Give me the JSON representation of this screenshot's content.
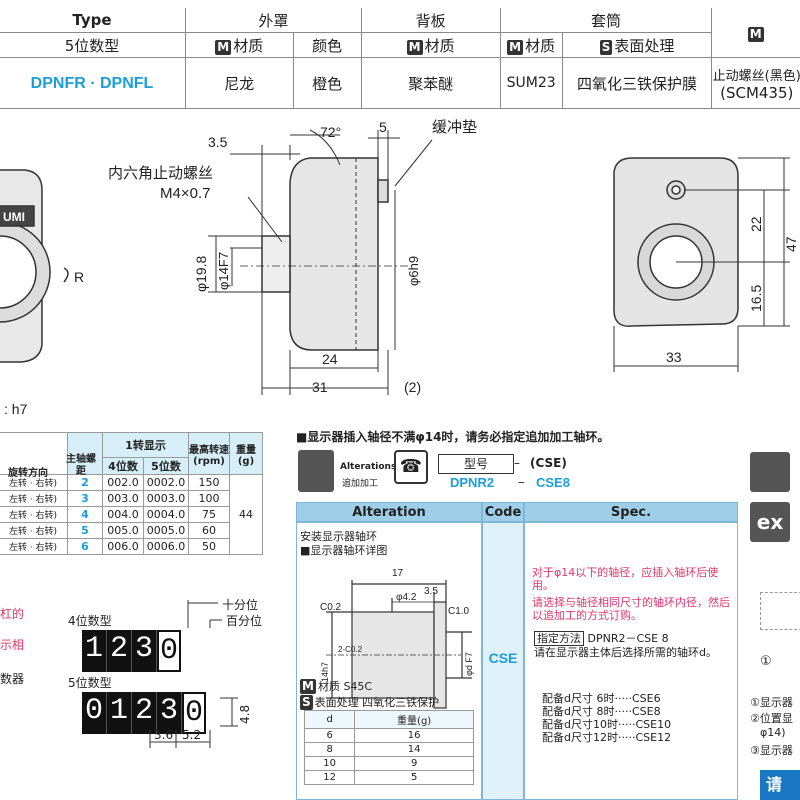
{
  "spec_table": {
    "type_header": "Type",
    "type_sub": "5位数型",
    "type_value": "DPNFR · DPNFL",
    "cover_header": "外罩",
    "cover_material_label": "材质",
    "cover_color_label": "颜色",
    "cover_material": "尼龙",
    "cover_color": "橙色",
    "back_header": "背板",
    "back_material_label": "材质",
    "back_material": "聚苯醚",
    "sleeve_header": "套筒",
    "sleeve_material_label": "材质",
    "sleeve_surface_label": "表面处理",
    "sleeve_material": "SUM23",
    "sleeve_surface": "四氧化三铁保护膜",
    "screw_value": "止动螺丝(黑色)",
    "screw_sub": "(SCM435)",
    "badge_m": "M",
    "badge_s": "S"
  },
  "drawing": {
    "logo_text": "UMI",
    "r_label": "R",
    "tolerance": ": h7",
    "dim_35": "3.5",
    "angle": "72°",
    "dim_5": "5",
    "buffer_pad": "缓冲垫",
    "setscrew_label": "内六角止动螺丝",
    "setscrew_size": "M4×0.7",
    "phi198": "φ19.8",
    "phi14": "φ14F7",
    "phi6": "φ6h9",
    "dim_24": "24",
    "dim_31": "31",
    "dim_2": "(2)",
    "dim_22": "22",
    "dim_47": "47",
    "dim_165": "16.5",
    "dim_33": "33"
  },
  "rpm_table": {
    "head_1rev": "1转显示",
    "head_max": "最高转速(rpm)",
    "head_weight": "重量(g)",
    "head_lead": "主轴螺距",
    "head_dir": "旋转方向",
    "head_4": "4位数",
    "head_5": "5位数",
    "rows": [
      {
        "dir": "左转 · 右转)",
        "lead": "2",
        "d4": "002.0",
        "d5": "0002.0",
        "rpm": "150"
      },
      {
        "dir": "左转 · 右转)",
        "lead": "3",
        "d4": "003.0",
        "d5": "0003.0",
        "rpm": "100"
      },
      {
        "dir": "左转 · 右转)",
        "lead": "4",
        "d4": "004.0",
        "d5": "0004.0",
        "rpm": "75"
      },
      {
        "dir": "左转 · 右转)",
        "lead": "5",
        "d4": "005.0",
        "d5": "0005.0",
        "rpm": "60"
      },
      {
        "dir": "左转 · 右转)",
        "lead": "6",
        "d4": "006.0",
        "d5": "0006.0",
        "rpm": "50"
      }
    ],
    "weight": "44"
  },
  "counters": {
    "label4": "4位数型",
    "label5": "5位数型",
    "digits4": [
      "1",
      "2",
      "3",
      "0"
    ],
    "digits5": [
      "0",
      "1",
      "2",
      "3",
      "0"
    ],
    "tenth": "十分位",
    "hundredth": "百分位",
    "h48": "4.8",
    "w36": "3.6",
    "w52": "5.2",
    "side1": "杠的",
    "side2": "示相",
    "side3": "数器"
  },
  "notice": {
    "text": "■显示器插入轴径不满φ14时，请务必指定追加加工轴环。",
    "alterations_label": "Alterations",
    "alterations_cn": "追加加工",
    "model_label": "型号",
    "code_label": "(CSE)",
    "model_value": "DPNR2",
    "code_value": "CSE8",
    "dash": "–"
  },
  "alteration_table": {
    "head_alt": "Alteration",
    "head_code": "Code",
    "head_spec": "Spec.",
    "title1": "安装显示器轴环",
    "title2": "■显示器轴环详图",
    "d17": "17",
    "c02": "C0.2",
    "phi42": "φ4.2",
    "d35": "3.5",
    "c10": "C1.0",
    "d14h7": "14h7",
    "dc02": "2-C0.2",
    "dphi": "φd F7",
    "material_label": "材质",
    "material": "S45C",
    "surface_label": "表面处理",
    "surface": "四氧化三铁保护",
    "col_d": "d",
    "col_weight": "重量(g)",
    "rows": [
      {
        "d": "6",
        "w": "16"
      },
      {
        "d": "8",
        "w": "14"
      },
      {
        "d": "10",
        "w": "9"
      },
      {
        "d": "12",
        "w": "5"
      }
    ],
    "code": "CSE",
    "spec_red1": "对于φ14以下的轴径，应插入轴环后使用。",
    "spec_red2": "请选择与轴径相同尺寸的轴环内径，然后以追加工的方式订购。",
    "spec_method_label": "指定方法",
    "spec_method": "DPNR2－CSE 8",
    "spec_note": "请在显示器主体后选择所需的轴环d。",
    "spec_lines": [
      "配备d尺寸 6时·····CSE6",
      "配备d尺寸 8时·····CSE8",
      "配备d尺寸10时·····CSE10",
      "配备d尺寸12时·····CSE12"
    ]
  },
  "right_side": {
    "ex_label": "ex",
    "circle1": "①",
    "item1": "①显示器",
    "item2": "②位置显",
    "item3": "φ14)",
    "item4": "③显示器",
    "bottom_btn": "请"
  }
}
